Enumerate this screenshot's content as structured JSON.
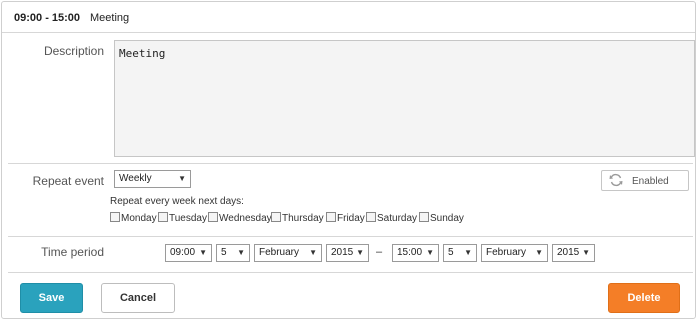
{
  "header": {
    "time": "09:00 - 15:00",
    "text": "Meeting"
  },
  "description": {
    "label": "Description",
    "value": "Meeting"
  },
  "repeat": {
    "label": "Repeat event",
    "frequency": "Weekly",
    "toggle_label": "Enabled",
    "hint": "Repeat every week next days:",
    "days": [
      "Monday",
      "Tuesday",
      "Wednesday",
      "Thursday",
      "Friday",
      "Saturday",
      "Sunday"
    ]
  },
  "time_period": {
    "label": "Time period",
    "start": {
      "time": "09:00",
      "day": "5",
      "month": "February",
      "year": "2015"
    },
    "separator": "–",
    "end": {
      "time": "15:00",
      "day": "5",
      "month": "February",
      "year": "2015"
    }
  },
  "buttons": {
    "save": "Save",
    "cancel": "Cancel",
    "delete": "Delete"
  },
  "colors": {
    "save": "#2aa2bd",
    "delete": "#f47e27"
  },
  "icons": {
    "toggle": "refresh-icon",
    "dropdown": "chevron-down-icon"
  }
}
